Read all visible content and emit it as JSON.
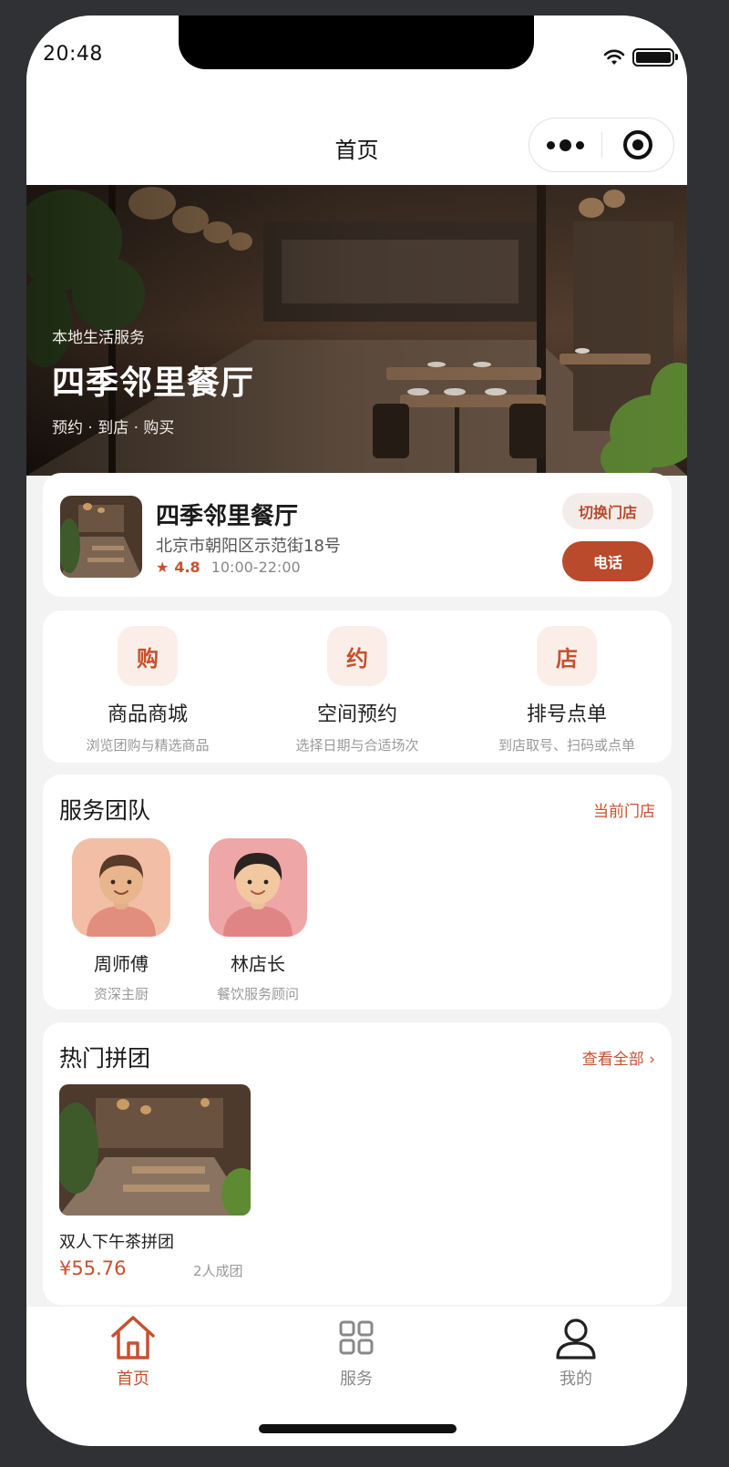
{
  "status_bar": {
    "time": "20:48"
  },
  "nav": {
    "title": "首页"
  },
  "hero": {
    "subtitle": "本地生活服务",
    "title": "四季邻里餐厅",
    "tags": "预约 · 到店 · 购买"
  },
  "store": {
    "name": "四季邻里餐厅",
    "address": "北京市朝阳区示范街18号",
    "rating": "4.8",
    "hours": "10:00-22:00",
    "switch_label": "切换门店",
    "call_label": "电话"
  },
  "quick_actions": [
    {
      "icon": "购",
      "title": "商品商城",
      "desc": "浏览团购与精选商品"
    },
    {
      "icon": "约",
      "title": "空间预约",
      "desc": "选择日期与合适场次"
    },
    {
      "icon": "店",
      "title": "排号点单",
      "desc": "到店取号、扫码或点单"
    }
  ],
  "team": {
    "title": "服务团队",
    "link": "当前门店",
    "members": [
      {
        "name": "周师傅",
        "role": "资深主厨"
      },
      {
        "name": "林店长",
        "role": "餐饮服务顾问"
      }
    ]
  },
  "group_buy": {
    "title": "热门拼团",
    "link": "查看全部 ›",
    "items": [
      {
        "name": "双人下午茶拼团",
        "price": "¥55.76",
        "size": "2人成团"
      }
    ]
  },
  "tabbar": [
    {
      "label": "首页",
      "icon": "home-icon",
      "active": true
    },
    {
      "label": "服务",
      "icon": "grid-icon",
      "active": false
    },
    {
      "label": "我的",
      "icon": "user-icon",
      "active": false
    }
  ],
  "colors": {
    "accent": "#c5512f",
    "accent_dark": "#b94a2c",
    "background": "#f3f3f3"
  }
}
